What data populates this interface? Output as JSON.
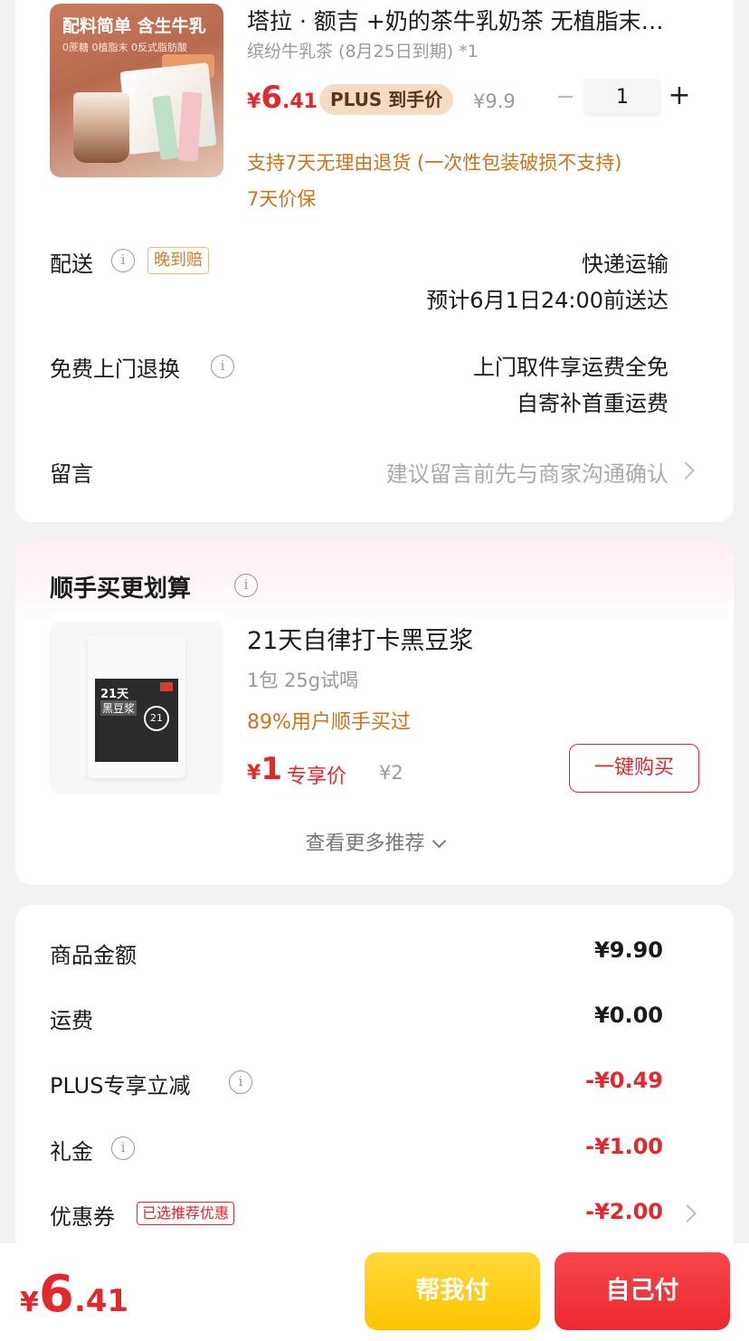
{
  "product": {
    "image_headline": "配料简单 含生牛乳",
    "image_subline": "0蔗糖 0植脂末 0反式脂肪酸",
    "title": "塔拉 · 额吉 +奶的茶牛乳奶茶 无植脂末…",
    "spec": "缤纷牛乳茶 (8月25日到期) *1",
    "price_yen": "¥",
    "price_int": "6",
    "price_dec": ".41",
    "plus_badge": "PLUS 到手价",
    "original_price": "¥9.9",
    "quantity": "1",
    "minus_symbol": "−",
    "plus_symbol": "+",
    "service_return": "支持7天无理由退货 (一次性包装破损不支持)",
    "service_price_protect": "7天价保"
  },
  "delivery": {
    "label": "配送",
    "late_badge": "晚到赔",
    "method": "快递运输",
    "eta": "预计6月1日24:00前送达"
  },
  "free_return": {
    "label": "免费上门退换",
    "line1": "上门取件享运费全免",
    "line2": "自寄补首重运费"
  },
  "message": {
    "label": "留言",
    "placeholder": "建议留言前先与商家沟通确认"
  },
  "recommend": {
    "title": "顺手买更划算",
    "bag_text1": "21天",
    "bag_text2": "黑豆浆",
    "bag_circle": "21",
    "name": "21天自律打卡黑豆浆",
    "spec": "1包 25g试喝",
    "stat": "89%用户顺手买过",
    "price_yen": "¥",
    "price_int": "1",
    "exclusive": "专享价",
    "original_price": "¥2",
    "buy_button": "一键购买",
    "more": "查看更多推荐"
  },
  "summary": {
    "rows": [
      {
        "label": "商品金额",
        "value": "¥9.90"
      },
      {
        "label": "运费",
        "value": "¥0.00"
      },
      {
        "label": "PLUS专享立减",
        "value": "-¥0.49"
      },
      {
        "label": "礼金",
        "value": "-¥1.00"
      },
      {
        "label": "优惠券",
        "value": "-¥2.00"
      }
    ],
    "coupon_badge": "已选推荐优惠"
  },
  "bottom": {
    "total_yen": "¥",
    "total_int": "6",
    "total_dec": ".41",
    "help_pay": "帮我付",
    "self_pay": "自己付"
  },
  "colors": {
    "accent_red": "#e4262d",
    "service_orange": "#c8741b",
    "help_yellow": "#ffc400"
  },
  "icons": {
    "info": "info-icon",
    "chevron_right": "chevron-right-icon",
    "chevron_down": "chevron-down-icon"
  }
}
